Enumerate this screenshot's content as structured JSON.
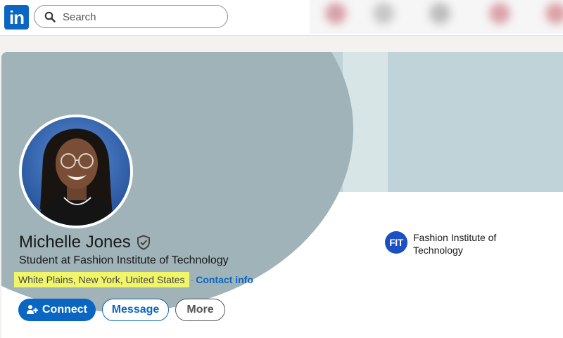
{
  "nav": {
    "logo_text": "in",
    "search_placeholder": "Search"
  },
  "profile": {
    "name": "Michelle Jones",
    "headline": "Student at Fashion Institute of Technology",
    "location": "White Plains, New York, United States",
    "separator": "·",
    "contact_link": "Contact info"
  },
  "actions": {
    "connect_label": "Connect",
    "message_label": "Message",
    "more_label": "More"
  },
  "education": {
    "logo_text": "FIT",
    "school_name": "Fashion Institute of Technology"
  },
  "colors": {
    "brand_blue": "#0a66c2",
    "location_highlight": "#f0f56a",
    "banner_dark": "#9fb3b8",
    "banner_light": "#c0d3d8"
  },
  "icons": [
    "search-icon",
    "verified-shield-icon",
    "add-person-icon"
  ]
}
